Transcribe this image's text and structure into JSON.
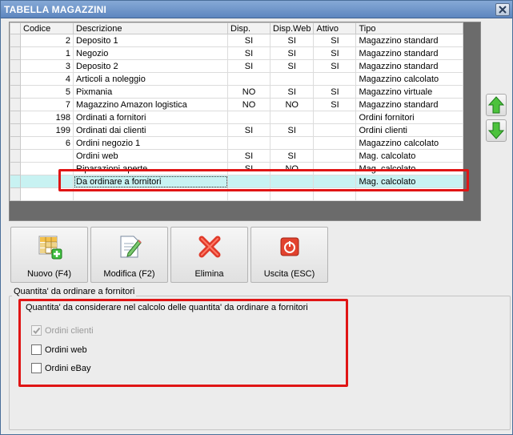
{
  "window": {
    "title": "TABELLA MAGAZZINI"
  },
  "grid": {
    "columns": [
      "Codice",
      "Descrizione",
      "Disp.",
      "Disp.Web",
      "Attivo",
      "Tipo"
    ],
    "rows": [
      {
        "codice": "2",
        "descrizione": "Deposito 1",
        "disp": "SI",
        "disp_web": "SI",
        "attivo": "SI",
        "tipo": "Magazzino standard"
      },
      {
        "codice": "1",
        "descrizione": "Negozio",
        "disp": "SI",
        "disp_web": "SI",
        "attivo": "SI",
        "tipo": "Magazzino standard"
      },
      {
        "codice": "3",
        "descrizione": "Deposito 2",
        "disp": "SI",
        "disp_web": "SI",
        "attivo": "SI",
        "tipo": "Magazzino standard"
      },
      {
        "codice": "4",
        "descrizione": "Articoli a noleggio",
        "disp": "",
        "disp_web": "",
        "attivo": "",
        "tipo": "Magazzino calcolato"
      },
      {
        "codice": "5",
        "descrizione": "Pixmania",
        "disp": "NO",
        "disp_web": "SI",
        "attivo": "SI",
        "tipo": "Magazzino virtuale"
      },
      {
        "codice": "7",
        "descrizione": "Magazzino Amazon logistica",
        "disp": "NO",
        "disp_web": "NO",
        "attivo": "SI",
        "tipo": "Magazzino standard"
      },
      {
        "codice": "198",
        "descrizione": "Ordinati a fornitori",
        "disp": "",
        "disp_web": "",
        "attivo": "",
        "tipo": "Ordini fornitori"
      },
      {
        "codice": "199",
        "descrizione": "Ordinati dai clienti",
        "disp": "SI",
        "disp_web": "SI",
        "attivo": "",
        "tipo": "Ordini clienti"
      },
      {
        "codice": "6",
        "descrizione": "Ordini negozio 1",
        "disp": "",
        "disp_web": "",
        "attivo": "",
        "tipo": "Magazzino calcolato"
      },
      {
        "codice": "",
        "descrizione": "Ordini web",
        "disp": "SI",
        "disp_web": "SI",
        "attivo": "",
        "tipo": "Mag. calcolato"
      },
      {
        "codice": "",
        "descrizione": "Riparazioni aperte",
        "disp": "SI",
        "disp_web": "NO",
        "attivo": "",
        "tipo": "Mag. calcolato"
      },
      {
        "codice": "",
        "descrizione": "Da ordinare a fornitori",
        "disp": "",
        "disp_web": "",
        "attivo": "",
        "tipo": "Mag. calcolato",
        "selected": true
      },
      {
        "codice": "",
        "descrizione": "",
        "disp": "",
        "disp_web": "",
        "attivo": "",
        "tipo": ""
      }
    ]
  },
  "side_buttons": {
    "up_icon": "green-up-arrow-icon",
    "down_icon": "green-down-arrow-icon"
  },
  "toolbar": [
    {
      "label": "Nuovo (F4)",
      "icon": "new-grid-icon"
    },
    {
      "label": "Modifica (F2)",
      "icon": "edit-document-icon"
    },
    {
      "label": "Elimina",
      "icon": "delete-x-icon"
    },
    {
      "label": "Uscita (ESC)",
      "icon": "exit-power-icon"
    }
  ],
  "group": {
    "title": "Quantita' da ordinare a fornitori",
    "description": "Quantita' da considerare nel calcolo delle quantita' da ordinare a fornitori",
    "checkboxes": [
      {
        "label": "Ordini clienti",
        "checked": true,
        "disabled": true
      },
      {
        "label": "Ordini web",
        "checked": false,
        "disabled": false
      },
      {
        "label": "Ordini eBay",
        "checked": false,
        "disabled": false
      }
    ]
  },
  "colors": {
    "highlight": "#e01515",
    "selected_row": "#c8f2f2",
    "title_bar": "#5d86bf"
  }
}
